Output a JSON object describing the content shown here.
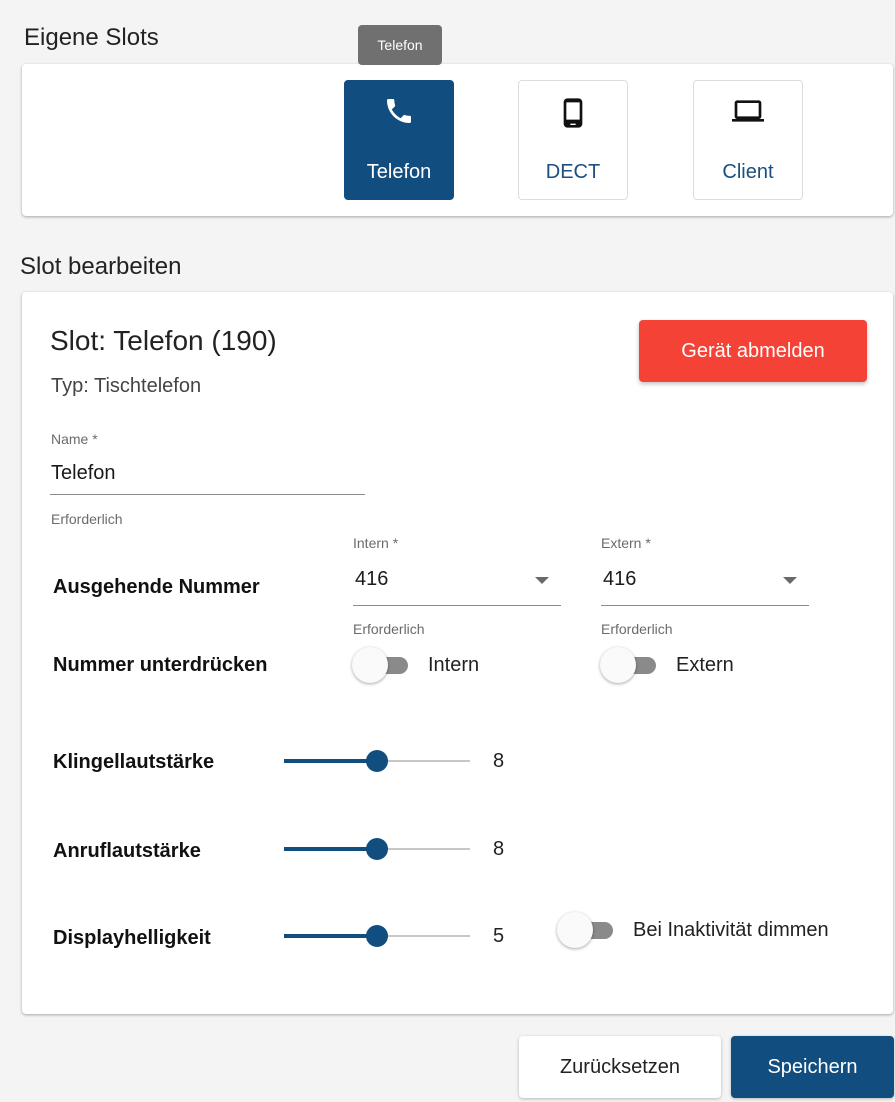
{
  "own_slots": {
    "title": "Eigene Slots",
    "tooltip": "Telefon",
    "slots": [
      {
        "label": "Telefon",
        "icon": "phone-icon",
        "active": true
      },
      {
        "label": "DECT",
        "icon": "mobile-icon",
        "active": false
      },
      {
        "label": "Client",
        "icon": "laptop-icon",
        "active": false
      }
    ]
  },
  "edit": {
    "title": "Slot bearbeiten",
    "slot_title": "Slot: Telefon (190)",
    "type": "Typ: Tischtelefon",
    "logout_button": "Gerät abmelden",
    "name_field": {
      "label": "Name *",
      "value": "Telefon",
      "hint": "Erforderlich"
    },
    "outgoing": {
      "label": "Ausgehende Nummer",
      "intern": {
        "label": "Intern *",
        "value": "416",
        "hint": "Erforderlich"
      },
      "extern": {
        "label": "Extern *",
        "value": "416",
        "hint": "Erforderlich"
      }
    },
    "suppress": {
      "label": "Nummer unterdrücken",
      "intern": {
        "label": "Intern",
        "on": false
      },
      "extern": {
        "label": "Extern",
        "on": false
      }
    },
    "ring_volume": {
      "label": "Klingellautstärke",
      "value": "8",
      "fraction": 0.5
    },
    "call_volume": {
      "label": "Anruflautstärke",
      "value": "8",
      "fraction": 0.5
    },
    "display_brightness": {
      "label": "Displayhelligkeit",
      "value": "5",
      "fraction": 0.5
    },
    "dim_inactive": {
      "label": "Bei Inaktivität dimmen",
      "on": false
    }
  },
  "actions": {
    "reset": "Zurücksetzen",
    "save": "Speichern"
  },
  "colors": {
    "primary": "#114d7f",
    "danger": "#f44336",
    "background": "#f4f4f4"
  }
}
